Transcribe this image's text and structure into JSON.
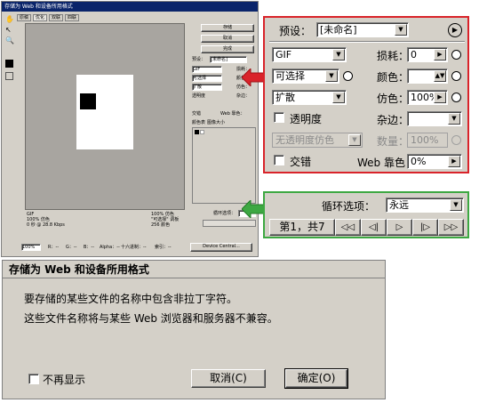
{
  "mini": {
    "title": "存储为 Web 和设备所用格式",
    "tabs": [
      "原稿",
      "优化",
      "双联",
      "四联"
    ],
    "buttons": [
      "存储",
      "取消",
      "完成"
    ],
    "preset_label": "预设：",
    "preset_value": "[未命名]",
    "rows": [
      {
        "sel": "GIF",
        "label": "损耗："
      },
      {
        "sel": "可选择",
        "label": "颜色："
      },
      {
        "sel": "扩散",
        "label": "仿色："
      }
    ],
    "transparency": "透明度",
    "matte": "杂边：",
    "interlaced": "交错",
    "web_snap": "Web 靠色：",
    "color_table_tabs": [
      "颜色表",
      "图像大小"
    ],
    "info_left": "GIF\n100% 仿色\n0 秒 @ 28.8 Kbps",
    "info_right": "100% 仿色\n\"可选择\" 调板\n256 颜色",
    "loop_label": "循环选项：",
    "zoom_value": "100%",
    "r": "R：--",
    "g": "G：--",
    "b": "B：--",
    "alpha": "Alpha：--",
    "hex": "十六进制：--",
    "index": "索引：--",
    "device_central": "Device Central..."
  },
  "zoom1": {
    "preset_label": "预设：",
    "preset_value": "[未命名]",
    "format": "GIF",
    "lossy_label": "损耗：",
    "lossy_value": "0",
    "palette": "可选择",
    "colors_label": "颜色：",
    "colors_value": "",
    "dither_algo": "扩散",
    "dither_label": "仿色：",
    "dither_value": "100%",
    "transparency_label": "透明度",
    "matte_label": "杂边：",
    "matte_value": "",
    "trans_dither": "无透明度仿色",
    "amount_label": "数量：",
    "amount_value": "100%",
    "interlaced_label": "交错",
    "web_snap_label": "Web 靠色：",
    "web_snap_value": "0%"
  },
  "zoom2": {
    "loop_label": "循环选项：",
    "loop_value": "永远",
    "frame_label": "第1，共7",
    "nav_glyphs": [
      "◁◁",
      "◁|",
      "▷",
      "|▷",
      "▷▷"
    ]
  },
  "dialog": {
    "title": "存储为 Web 和设备所用格式",
    "line1": "要存储的某些文件的名称中包含非拉丁字符。",
    "line2": "这些文件名称将与某些 Web 浏览器和服务器不兼容。",
    "dont_show": "不再显示",
    "cancel": "取消(C)",
    "ok": "确定(O)"
  },
  "colors": {
    "red": "#d9232a",
    "green": "#3da842",
    "title_bar": "#0a246a",
    "canvas": "#a8a5a0"
  }
}
